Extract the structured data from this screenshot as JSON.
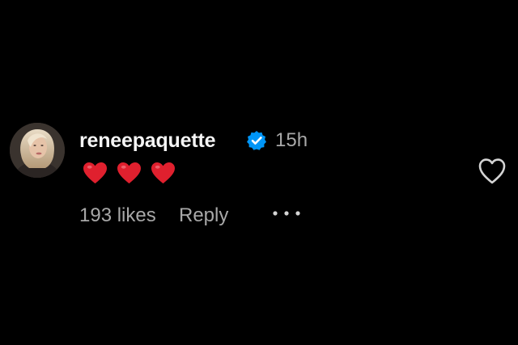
{
  "comment": {
    "username": "reneepaquette",
    "verified": true,
    "timestamp": "15h",
    "emojis": [
      "heart",
      "heart",
      "heart"
    ],
    "likes_label": "193 likes",
    "reply_label": "Reply",
    "more_icon": "more-icon",
    "like_icon": "heart-outline-icon"
  },
  "colors": {
    "background": "#000000",
    "text_primary": "#f5f5f5",
    "text_secondary": "#a8a8a8",
    "verified_blue": "#0095f6",
    "emoji_red": "#e0202e"
  }
}
